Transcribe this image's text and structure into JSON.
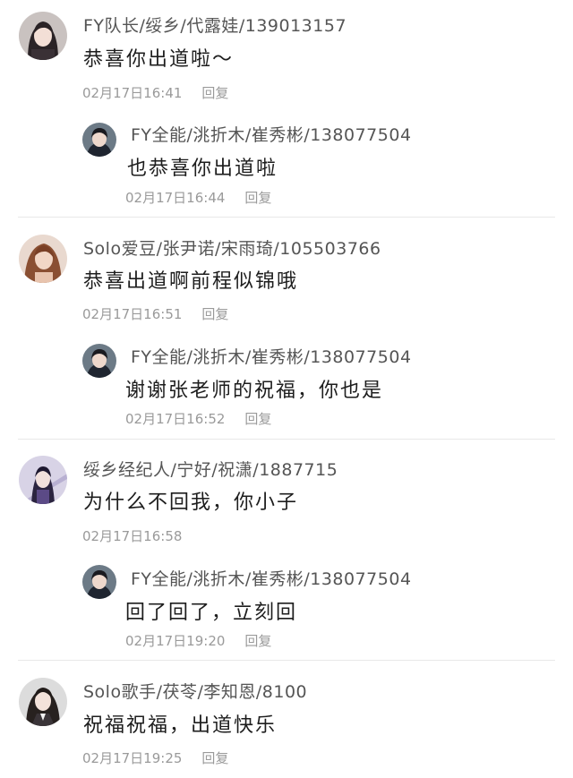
{
  "comments": [
    {
      "name": "FY队长/绥乡/代露娃/139013157",
      "text": "恭喜你出道啦～",
      "time": "02月17日16:41",
      "reply_label": "回复",
      "reply": {
        "name": "FY全能/洮折木/崔秀彬/138077504",
        "text": "也恭喜你出道啦",
        "time": "02月17日16:44",
        "reply_label": "回复"
      }
    },
    {
      "name": "Solo爱豆/张尹诺/宋雨琦/105503766",
      "text": "恭喜出道啊前程似锦哦",
      "time": "02月17日16:51",
      "reply_label": "回复",
      "reply": {
        "name": "FY全能/洮折木/崔秀彬/138077504",
        "text": "谢谢张老师的祝福，你也是",
        "time": "02月17日16:52",
        "reply_label": "回复"
      }
    },
    {
      "name": "绥乡经纪人/宁好/祝潇/1887715",
      "text": "为什么不回我，你小子",
      "time": "02月17日16:58",
      "reply": {
        "name": "FY全能/洮折木/崔秀彬/138077504",
        "text": "回了回了，立刻回",
        "time": "02月17日19:20",
        "reply_label": "回复"
      }
    },
    {
      "name": "Solo歌手/茯苓/李知恩/8100",
      "text": "祝福祝福，出道快乐",
      "time": "02月17日19:25",
      "reply_label": "回复"
    }
  ]
}
